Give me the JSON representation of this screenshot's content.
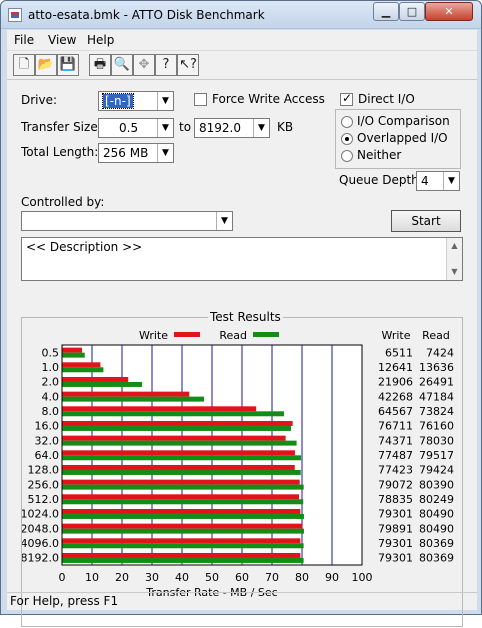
{
  "window": {
    "title": "atto-esata.bmk - ATTO Disk Benchmark"
  },
  "menu": {
    "file": "File",
    "view": "View",
    "help": "Help"
  },
  "toolbar": {
    "buttons": [
      "new-icon",
      "open-icon",
      "save-icon",
      "print-icon",
      "print-preview-icon",
      "move-icon",
      "help-icon",
      "context-help-icon"
    ]
  },
  "form": {
    "drive_label": "Drive:",
    "drive_value": "[-n-]",
    "force_write_label": "Force Write Access",
    "direct_io_label": "Direct I/O",
    "direct_io_checked": true,
    "transfer_size_label": "Transfer Size:",
    "transfer_from": "0.5",
    "transfer_to_label": "to",
    "transfer_to": "8192.0",
    "transfer_unit": "KB",
    "total_length_label": "Total Length:",
    "total_length": "256 MB",
    "io_comparison": "I/O Comparison",
    "overlapped_io": "Overlapped I/O",
    "neither": "Neither",
    "selected_mode": "Overlapped I/O",
    "queue_depth_label": "Queue Depth:",
    "queue_depth": "4",
    "controlled_by_label": "Controlled by:",
    "controlled_by_value": "",
    "start_button": "Start",
    "description": "<< Description >>"
  },
  "results": {
    "title": "Test Results",
    "write_legend": "Write",
    "read_legend": "Read",
    "write_header": "Write",
    "read_header": "Read",
    "colors": {
      "write": "#e0141b",
      "read": "#168c18"
    }
  },
  "chart_data": {
    "type": "bar",
    "orientation": "horizontal",
    "categories": [
      "0.5",
      "1.0",
      "2.0",
      "4.0",
      "8.0",
      "16.0",
      "32.0",
      "64.0",
      "128.0",
      "256.0",
      "512.0",
      "1024.0",
      "2048.0",
      "4096.0",
      "8192.0"
    ],
    "series": [
      {
        "name": "Write",
        "values": [
          6511,
          12641,
          21906,
          42268,
          64567,
          76711,
          74371,
          77487,
          77423,
          79072,
          78835,
          79301,
          79891,
          79301,
          79301
        ]
      },
      {
        "name": "Read",
        "values": [
          7424,
          13636,
          26491,
          47184,
          73824,
          76160,
          78030,
          79517,
          79424,
          80390,
          80249,
          80490,
          80490,
          80369,
          80369
        ]
      }
    ],
    "xlabel": "Transfer Rate - MB / Sec",
    "xticks": [
      0,
      10,
      20,
      30,
      40,
      50,
      60,
      70,
      80,
      90,
      100
    ],
    "xlim": [
      0,
      100
    ],
    "values_unit": "KB/s"
  },
  "statusbar": {
    "text": "For Help, press F1"
  }
}
